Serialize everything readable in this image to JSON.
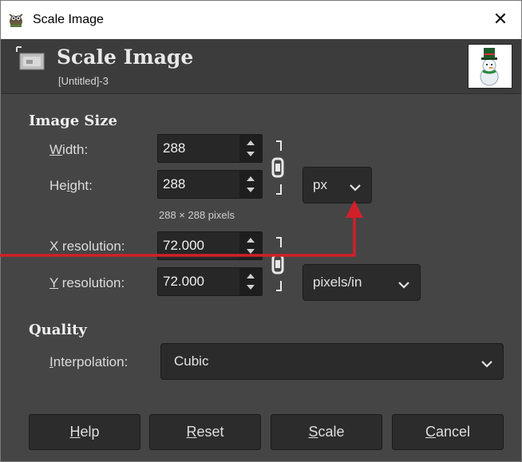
{
  "window": {
    "title": "Scale Image",
    "close_glyph": "✕"
  },
  "header": {
    "title": "Scale Image",
    "subtitle": "[Untitled]-3"
  },
  "image_size": {
    "section_title": "Image Size",
    "width_label": "Width:",
    "width_mnemonic": "W",
    "width_rest": "idth:",
    "width_value": "288",
    "height_label": "Height:",
    "height_pre": "He",
    "height_mnemonic": "i",
    "height_rest": "ght:",
    "height_value": "288",
    "size_unit": "px",
    "pixels_note": "288 × 288 pixels",
    "x_res_label": "X resolution:",
    "x_res_value": "72.000",
    "y_res_label": "Y resolution:",
    "y_res_mnemonic": "Y",
    "y_res_rest": " resolution:",
    "y_res_value": "72.000",
    "res_unit": "pixels/in"
  },
  "quality": {
    "section_title": "Quality",
    "interpolation_label": "Interpolation:",
    "interp_mnemonic": "I",
    "interp_rest": "nterpolation:",
    "interpolation_value": "Cubic"
  },
  "buttons": {
    "help_mnemonic": "H",
    "help_rest": "elp",
    "reset_mnemonic": "R",
    "reset_rest": "eset",
    "scale_mnemonic": "S",
    "scale_rest": "cale",
    "cancel_mnemonic": "C",
    "cancel_rest": "ancel"
  },
  "icons": {
    "app": "gimp-wilber-icon",
    "header": "scale-image-icon",
    "thumbnail": "snowman-thumbnail",
    "chain": "chain-link-icon",
    "spin": "spin-arrows-icon",
    "dropdown": "chevron-down-icon"
  },
  "colors": {
    "dialog_bg": "#454545",
    "field_bg": "#272727",
    "annotation": "#d0202a"
  }
}
